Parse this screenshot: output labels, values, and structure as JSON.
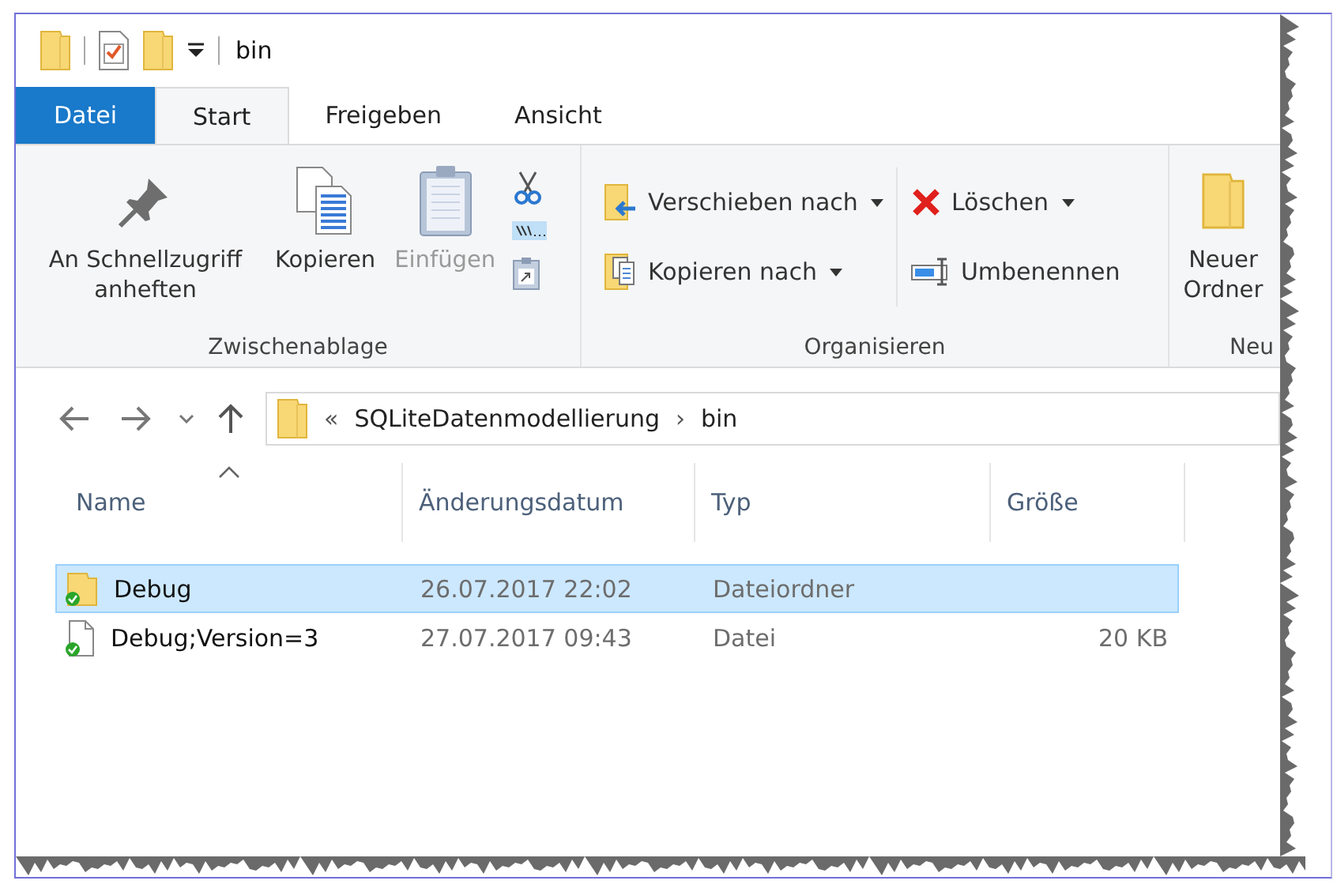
{
  "window": {
    "title": "bin"
  },
  "tabs": [
    {
      "label": "Datei",
      "kind": "file",
      "selected": false
    },
    {
      "label": "Start",
      "kind": "tab",
      "selected": true
    },
    {
      "label": "Freigeben",
      "kind": "tab",
      "selected": false
    },
    {
      "label": "Ansicht",
      "kind": "tab",
      "selected": false
    }
  ],
  "ribbon": {
    "groups": [
      {
        "label": "Zwischenablage",
        "kind": "clipboard",
        "large_buttons": [
          {
            "label": "An Schnellzugriff anheften",
            "kind": "pin",
            "disabled": false
          },
          {
            "label": "Kopieren",
            "kind": "copy",
            "disabled": false
          },
          {
            "label": "Einfügen",
            "kind": "paste",
            "disabled": true
          }
        ]
      },
      {
        "label": "Organisieren",
        "kind": "organize",
        "small_buttons": [
          {
            "label": "Verschieben nach",
            "kind": "move",
            "dropdown": true
          },
          {
            "label": "Kopieren nach",
            "kind": "copyto",
            "dropdown": true
          },
          {
            "label": "Löschen",
            "kind": "delete",
            "dropdown": true
          },
          {
            "label": "Umbenennen",
            "kind": "rename",
            "dropdown": false
          }
        ]
      },
      {
        "label": "Neu",
        "kind": "new",
        "large_buttons": [
          {
            "label": "Neuer Ordner",
            "kind": "folder",
            "disabled": false
          }
        ]
      }
    ]
  },
  "address": {
    "overflow": "«",
    "segments": [
      "SQLiteDatenmodellierung",
      "bin"
    ],
    "separator": "›"
  },
  "columns": [
    {
      "label": "Name",
      "sorted": true
    },
    {
      "label": "Änderungsdatum",
      "sorted": false
    },
    {
      "label": "Typ",
      "sorted": false
    },
    {
      "label": "Größe",
      "sorted": false
    }
  ],
  "rows": [
    {
      "kind": "folder",
      "name": "Debug",
      "date": "26.07.2017 22:02",
      "type": "Dateiordner",
      "selected": true
    },
    {
      "kind": "file",
      "name": "Debug;Version=3",
      "date": "27.07.2017 09:43",
      "type": "Datei",
      "size": "20 KB",
      "selected": false
    }
  ]
}
